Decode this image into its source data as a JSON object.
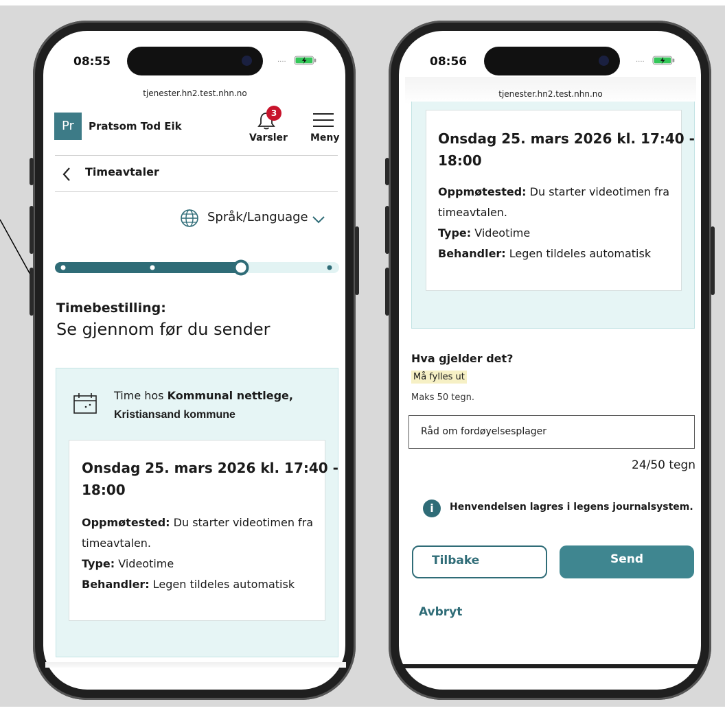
{
  "left_phone": {
    "status_time": "08:55",
    "url": "tjenester.hn2.test.nhn.no",
    "avatar_initials": "Pr",
    "user_name": "Pratsom Tod Eik",
    "notifications_count": "3",
    "notifications_label": "Varsler",
    "menu_label": "Meny",
    "back_label": "Timeavtaler",
    "language_label": "Språk/Language",
    "progress": {
      "steps": 4,
      "current_step": 3
    },
    "heading_small": "Timebestilling:",
    "heading_big": "Se gjennom før du sender",
    "appointment_with_prefix": "Time hos",
    "appointment_with_bold_1": "Kommunal nettlege,",
    "appointment_with_bold_2": "Kristiansand kommune",
    "card": {
      "date_line1": "Onsdag 25. mars 2026 kl. 17:40 -",
      "date_line2": "18:00",
      "location_label": "Oppmøtested:",
      "location_text_1": "Du starter videotimen fra",
      "location_text_2": "timeavtalen.",
      "type_label": "Type:",
      "type_value": "Videotime",
      "provider_label": "Behandler:",
      "provider_value": "Legen tildeles automatisk"
    }
  },
  "right_phone": {
    "status_time": "08:56",
    "url": "tjenester.hn2.test.nhn.no",
    "card": {
      "date_line1": "Onsdag 25. mars 2026 kl. 17:40 -",
      "date_line2": "18:00",
      "location_label": "Oppmøtested:",
      "location_text_1": "Du starter videotimen fra",
      "location_text_2": "timeavtalen.",
      "type_label": "Type:",
      "type_value": "Videotime",
      "provider_label": "Behandler:",
      "provider_value": "Legen tildeles automatisk"
    },
    "question_label": "Hva gjelder det?",
    "required_label": "Må fylles ut",
    "max_hint": "Maks 50 tegn.",
    "input_value": "Råd om fordøyelsesplager",
    "char_counter": "24/50 tegn",
    "info_text": "Henvendelsen lagres i legens journalsystem.",
    "back_button": "Tilbake",
    "send_button": "Send",
    "cancel_link": "Avbryt"
  },
  "colors": {
    "accent": "#2f6c77",
    "panel": "#e6f5f5",
    "badge": "#c8142c",
    "required_bg": "#f6f0c5"
  }
}
